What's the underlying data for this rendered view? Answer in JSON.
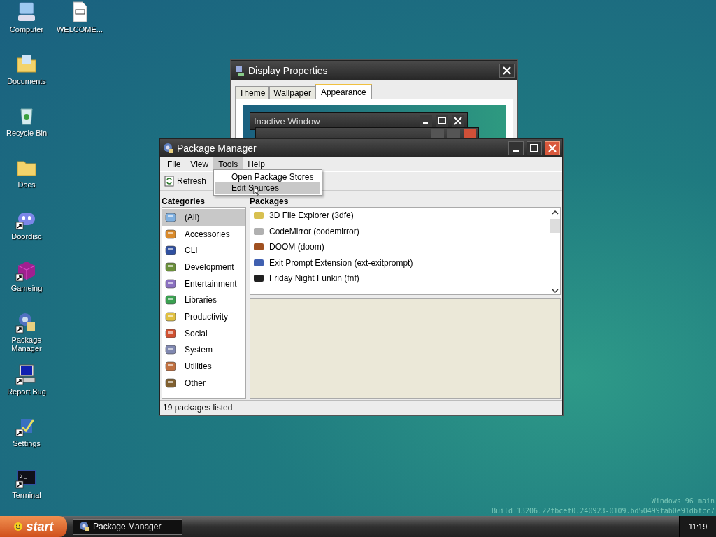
{
  "desktop": {
    "icons": [
      {
        "label": "Computer",
        "kind": "computer",
        "shortcut": false
      },
      {
        "label": "Documents",
        "kind": "documents",
        "shortcut": false
      },
      {
        "label": "Recycle Bin",
        "kind": "recycle",
        "shortcut": false
      },
      {
        "label": "Docs",
        "kind": "folder",
        "shortcut": false
      },
      {
        "label": "Doordisc",
        "kind": "chat",
        "shortcut": true
      },
      {
        "label": "Gameing",
        "kind": "cube",
        "shortcut": true
      },
      {
        "label": "Package Manager",
        "kind": "package",
        "shortcut": true
      },
      {
        "label": "Report Bug",
        "kind": "monitor",
        "shortcut": true
      },
      {
        "label": "Settings",
        "kind": "settings",
        "shortcut": true
      },
      {
        "label": "Terminal",
        "kind": "terminal",
        "shortcut": true
      },
      {
        "label": "WELCOME...",
        "kind": "markdown",
        "shortcut": false
      }
    ]
  },
  "display_properties": {
    "title": "Display Properties",
    "tabs": [
      {
        "label": "Theme",
        "selected": false
      },
      {
        "label": "Wallpaper",
        "selected": false
      },
      {
        "label": "Appearance",
        "selected": true
      }
    ],
    "preview": {
      "inactive_title": "Inactive Window"
    }
  },
  "package_manager": {
    "title": "Package Manager",
    "menu": [
      {
        "label": "File",
        "selected": false
      },
      {
        "label": "View",
        "selected": false
      },
      {
        "label": "Tools",
        "selected": true
      },
      {
        "label": "Help",
        "selected": false
      }
    ],
    "dropdown": [
      {
        "label": "Open Package Stores",
        "selected": false
      },
      {
        "label": "Edit Sources",
        "selected": true
      }
    ],
    "toolbar": [
      {
        "label": "Refresh"
      }
    ],
    "categories_heading": "Categories",
    "packages_heading": "Packages",
    "categories": [
      {
        "label": "(All)",
        "selected": true
      },
      {
        "label": "Accessories",
        "selected": false
      },
      {
        "label": "CLI",
        "selected": false
      },
      {
        "label": "Development",
        "selected": false
      },
      {
        "label": "Entertainment",
        "selected": false
      },
      {
        "label": "Libraries",
        "selected": false
      },
      {
        "label": "Productivity",
        "selected": false
      },
      {
        "label": "Social",
        "selected": false
      },
      {
        "label": "System",
        "selected": false
      },
      {
        "label": "Utilities",
        "selected": false
      },
      {
        "label": "Other",
        "selected": false
      }
    ],
    "packages": [
      {
        "label": "3D File Explorer (3dfe)"
      },
      {
        "label": "CodeMirror (codemirror)"
      },
      {
        "label": "DOOM (doom)"
      },
      {
        "label": "Exit Prompt Extension (ext-exitprompt)"
      },
      {
        "label": "Friday Night Funkin (fnf)"
      }
    ],
    "status": "19 packages listed"
  },
  "build_info": [
    "Windows 96 main",
    "Build 13206.22fbcef0.240923-0109.bd50499fab0e91dbfcc7"
  ],
  "taskbar": {
    "start": "start",
    "tasks": [
      {
        "label": "Package Manager",
        "selected": true
      }
    ],
    "clock": "11:19"
  }
}
